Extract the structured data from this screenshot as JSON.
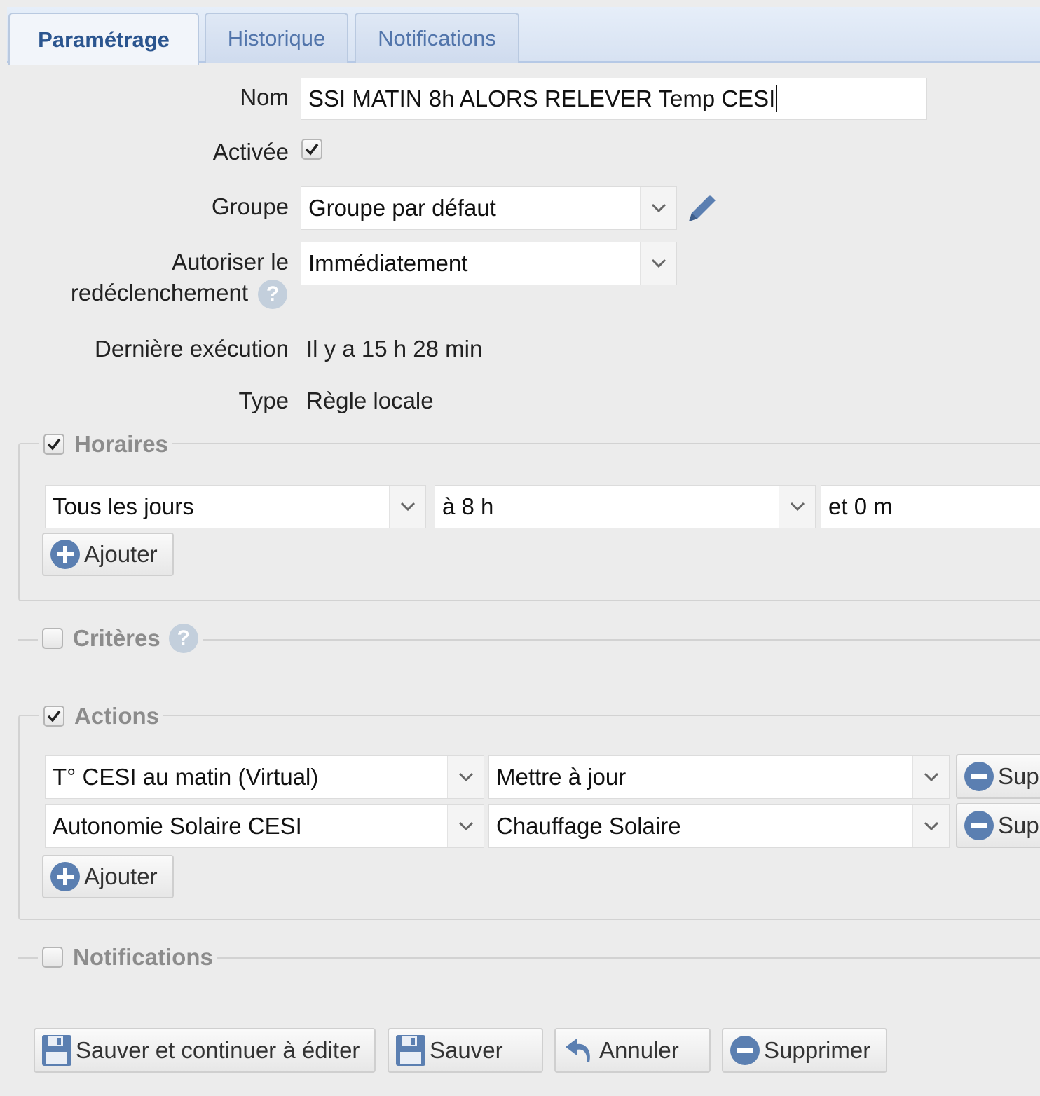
{
  "tabs": [
    {
      "label": "Paramétrage",
      "active": true
    },
    {
      "label": "Historique",
      "active": false
    },
    {
      "label": "Notifications",
      "active": false
    }
  ],
  "form": {
    "nom_label": "Nom",
    "nom_value": "SSI MATIN 8h ALORS RELEVER Temp CESI",
    "activee_label": "Activée",
    "activee_checked": true,
    "groupe_label": "Groupe",
    "groupe_value": "Groupe par défaut",
    "redecl_label_line1": "Autoriser le",
    "redecl_label_line2": "redéclenchement",
    "redecl_value": "Immédiatement",
    "derniere_label": "Dernière exécution",
    "derniere_value": "Il y a 15 h 28 min",
    "type_label": "Type",
    "type_value": "Règle locale"
  },
  "horaires": {
    "legend": "Horaires",
    "checked": true,
    "day_value": "Tous les jours",
    "hour_value": "à 8 h",
    "minute_value": "et 0 m",
    "add_label": "Ajouter"
  },
  "criteres": {
    "legend": "Critères",
    "checked": false
  },
  "actions": {
    "legend": "Actions",
    "checked": true,
    "rows": [
      {
        "device": "T° CESI au matin (Virtual)",
        "action": "Mettre à jour",
        "remove_label": "Sup"
      },
      {
        "device": "Autonomie Solaire CESI",
        "action": "Chauffage Solaire",
        "remove_label": "Sup"
      }
    ],
    "add_label": "Ajouter"
  },
  "notifications": {
    "legend": "Notifications",
    "checked": false
  },
  "buttons": {
    "save_continue": "Sauver et continuer à éditer",
    "save": "Sauver",
    "cancel": "Annuler",
    "delete": "Supprimer"
  },
  "colors": {
    "accent": "#2b558f",
    "tab_text": "#5275ab",
    "icon_blue": "#5b7fb1",
    "help_icon": "#c3cfdc"
  }
}
